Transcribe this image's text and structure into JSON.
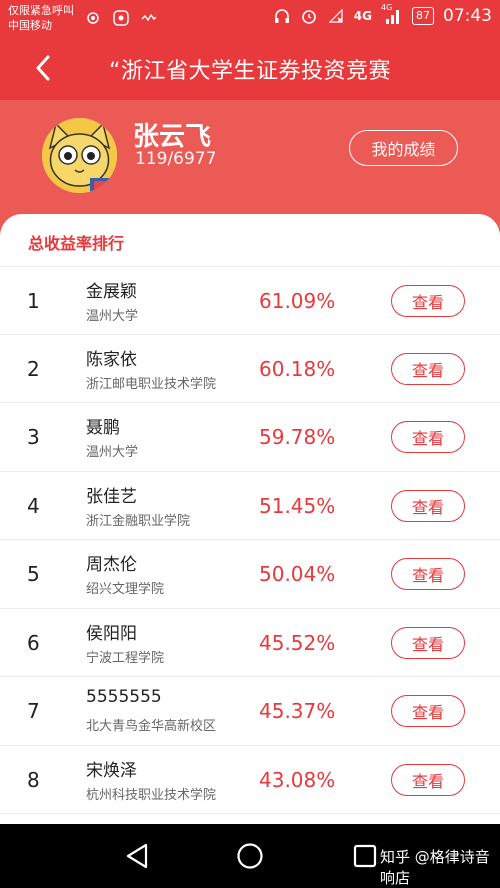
{
  "status": {
    "emergency": "仅限紧急呼叫",
    "carrier": "中国移动",
    "network": "4G",
    "network2": "4G",
    "battery": "87",
    "time": "07:43"
  },
  "header": {
    "title": "“浙江省大学生证券投资竞赛"
  },
  "profile": {
    "name": "张云飞",
    "rank": "119/6977",
    "score_button": "我的成绩"
  },
  "ranking": {
    "title": "总收益率排行",
    "view_label": "查看",
    "rows": [
      {
        "rank": "1",
        "name": "金展颖",
        "school": "温州大学",
        "rate": "61.09%"
      },
      {
        "rank": "2",
        "name": "陈家依",
        "school": "浙江邮电职业技术学院",
        "rate": "60.18%"
      },
      {
        "rank": "3",
        "name": "聂鹏",
        "school": "温州大学",
        "rate": "59.78%"
      },
      {
        "rank": "4",
        "name": "张佳艺",
        "school": "浙江金融职业学院",
        "rate": "51.45%"
      },
      {
        "rank": "5",
        "name": "周杰伦",
        "school": "绍兴文理学院",
        "rate": "50.04%"
      },
      {
        "rank": "6",
        "name": "侯阳阳",
        "school": "宁波工程学院",
        "rate": "45.52%"
      },
      {
        "rank": "7",
        "name": "5555555",
        "school": "北大青鸟金华高新校区",
        "rate": "45.37%"
      },
      {
        "rank": "8",
        "name": "宋焕泽",
        "school": "杭州科技职业技术学院",
        "rate": "43.08%"
      }
    ]
  },
  "watermark": "知乎 @格律诗音响店",
  "colors": {
    "accent": "#e8393c",
    "profile_bg": "#ec5a55"
  }
}
